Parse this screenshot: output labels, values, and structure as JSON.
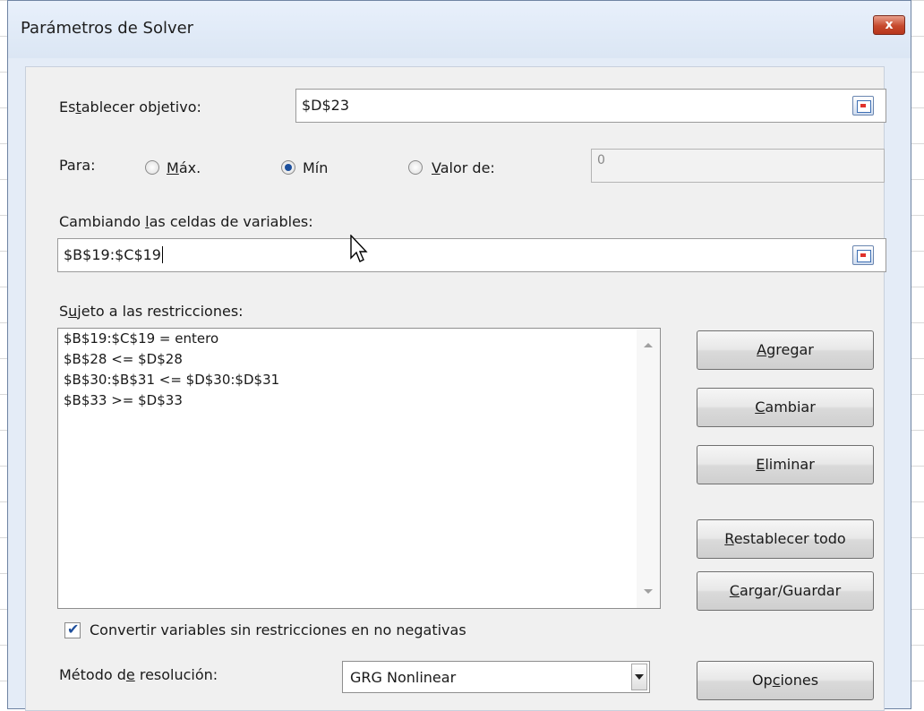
{
  "window": {
    "title": "Parámetros de Solver",
    "close_glyph": "x"
  },
  "objective": {
    "label_pre": "Es",
    "label_u": "t",
    "label_post": "ablecer objetivo:",
    "value": "$D$23"
  },
  "para": {
    "label": "Para:",
    "max": {
      "u": "M",
      "rest": "áx.",
      "checked": false
    },
    "min": {
      "label": "Mín",
      "checked": true
    },
    "valor": {
      "u": "V",
      "rest": "alor de:",
      "checked": false
    },
    "valor_input": "0"
  },
  "variables": {
    "label_pre": "Cambiando ",
    "label_u": "l",
    "label_post": "as celdas de variables:",
    "value": "$B$19:$C$19"
  },
  "constraints": {
    "label_pre": "S",
    "label_u": "u",
    "label_post": "jeto a las restricciones:",
    "items": [
      "$B$19:$C$19 = entero",
      "$B$28 <= $D$28",
      "$B$30:$B$31 <= $D$30:$D$31",
      "$B$33 >= $D$33"
    ]
  },
  "buttons": {
    "agregar": {
      "u": "A",
      "rest": "gregar"
    },
    "cambiar": {
      "u": "C",
      "rest": "ambiar"
    },
    "eliminar": {
      "u": "E",
      "rest": "liminar"
    },
    "restablecer": {
      "u": "R",
      "rest": "establecer todo"
    },
    "cargar": {
      "u": "C",
      "rest": "argar/Guardar"
    },
    "opciones": {
      "pre": "Op",
      "u": "c",
      "rest": "iones"
    }
  },
  "nonneg": {
    "label": "Convertir variables sin restricciones en no negativas",
    "checked": true
  },
  "method": {
    "label_pre": "Método d",
    "label_u": "e",
    "label_post": " resolución:",
    "value": "GRG Nonlinear"
  },
  "colors": {
    "accent": "#1c4f9c",
    "close": "#c6492d",
    "dialog_bg": "#f0f0f0"
  }
}
